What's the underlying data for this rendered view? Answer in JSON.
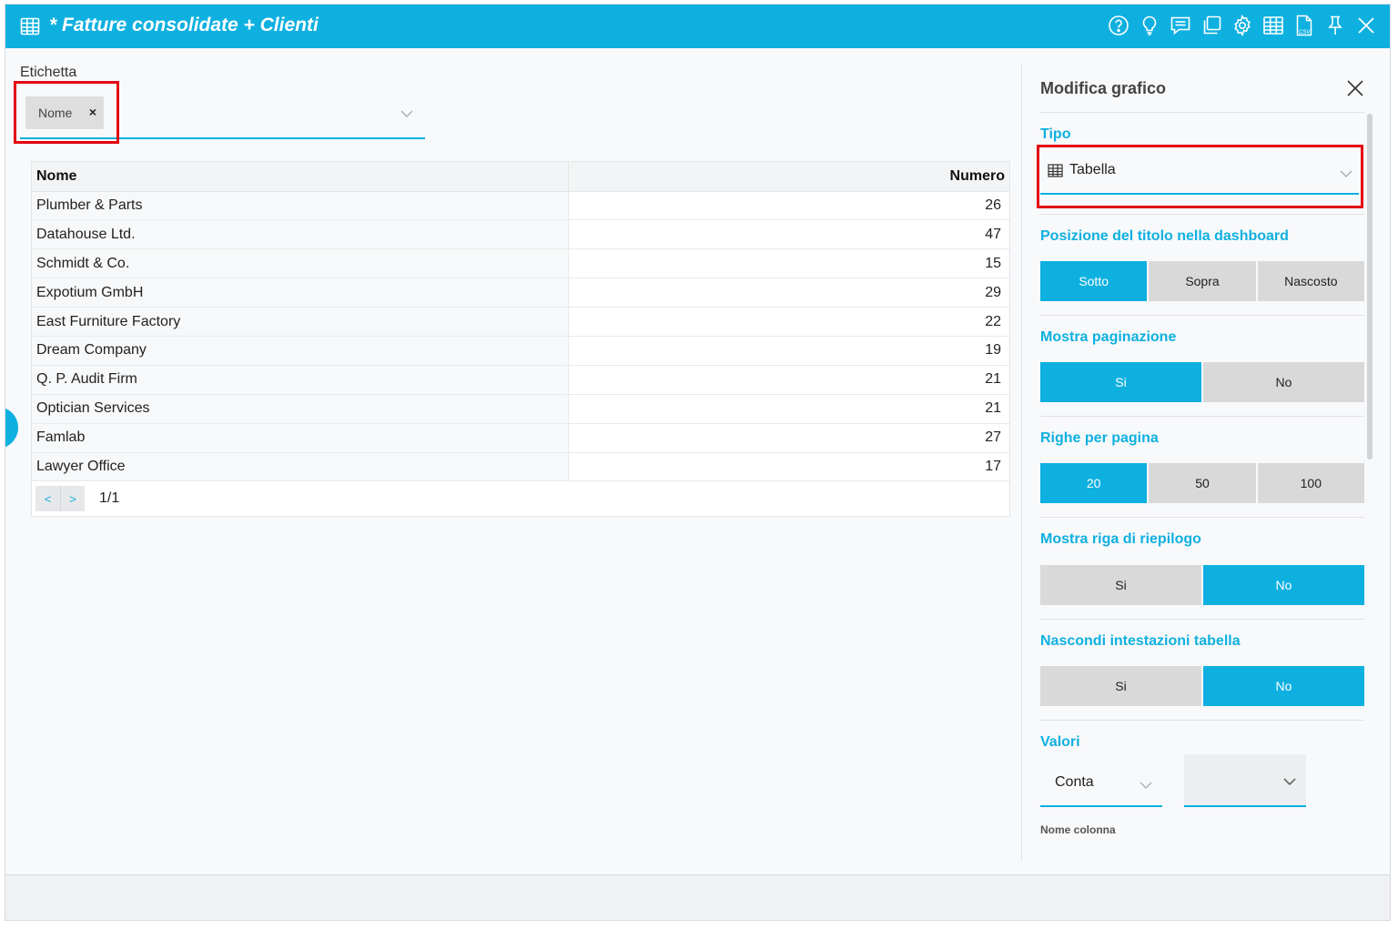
{
  "window": {
    "title": "* Fatture consolidate + Clienti",
    "accent": "#0eb0e0",
    "highlight": "#e30613",
    "toolbar_icons": [
      "help-icon",
      "lightbulb-icon",
      "comment-icon",
      "copy-icon",
      "gear-icon",
      "table-icon",
      "csv-icon",
      "pin-icon",
      "close-icon"
    ]
  },
  "label_field": {
    "label": "Etichetta",
    "chip": "Nome",
    "chip_remove": "×"
  },
  "table": {
    "headers": [
      "Nome",
      "Numero"
    ],
    "rows": [
      {
        "name": "Plumber & Parts",
        "value": "26"
      },
      {
        "name": "Datahouse Ltd.",
        "value": "47"
      },
      {
        "name": "Schmidt & Co.",
        "value": "15"
      },
      {
        "name": "Expotium GmbH",
        "value": "29"
      },
      {
        "name": "East Furniture Factory",
        "value": "22"
      },
      {
        "name": "Dream Company",
        "value": "19"
      },
      {
        "name": "Q. P. Audit Firm",
        "value": "21"
      },
      {
        "name": "Optician Services",
        "value": "21"
      },
      {
        "name": "Famlab",
        "value": "27"
      },
      {
        "name": "Lawyer Office",
        "value": "17"
      }
    ],
    "pager": {
      "prev": "<",
      "next": ">",
      "page_info": "1/1"
    }
  },
  "panel": {
    "title": "Modifica grafico",
    "tipo": {
      "label": "Tipo",
      "value": "Tabella"
    },
    "title_position": {
      "label": "Posizione del titolo nella dashboard",
      "options": [
        "Sotto",
        "Sopra",
        "Nascosto"
      ],
      "selected": "Sotto"
    },
    "pagination": {
      "label": "Mostra paginazione",
      "options": [
        "Si",
        "No"
      ],
      "selected": "Si"
    },
    "rows_per_page": {
      "label": "Righe per pagina",
      "options": [
        "20",
        "50",
        "100"
      ],
      "selected": "20"
    },
    "summary_row": {
      "label": "Mostra riga di riepilogo",
      "options": [
        "Si",
        "No"
      ],
      "selected": "No"
    },
    "hide_headers": {
      "label": "Nascondi intestazioni tabella",
      "options": [
        "Si",
        "No"
      ],
      "selected": "No"
    },
    "valori": {
      "label": "Valori",
      "aggregation": "Conta",
      "field": ""
    },
    "column_name_label": "Nome colonna"
  }
}
